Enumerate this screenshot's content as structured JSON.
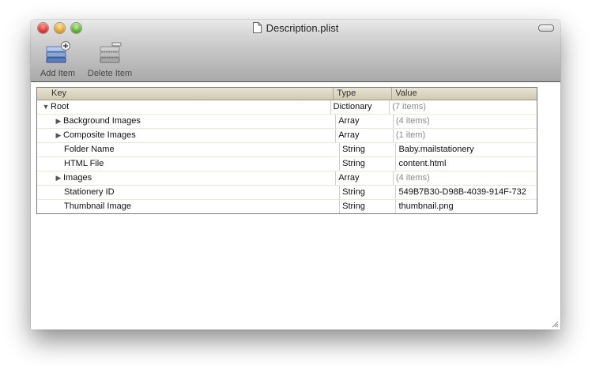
{
  "window": {
    "title": "Description.plist"
  },
  "toolbar": {
    "add_label": "Add Item",
    "delete_label": "Delete Item"
  },
  "table": {
    "headers": {
      "key": "Key",
      "type": "Type",
      "value": "Value"
    },
    "rows": [
      {
        "key": "Root",
        "type": "Dictionary",
        "value": "(7 items)",
        "expander": "expanded"
      },
      {
        "key": "Background Images",
        "type": "Array",
        "value": "(4 items)",
        "expander": "collapsed"
      },
      {
        "key": "Composite Images",
        "type": "Array",
        "value": "(1 item)",
        "expander": "collapsed"
      },
      {
        "key": "Folder Name",
        "type": "String",
        "value": "Baby.mailstationery",
        "expander": "none"
      },
      {
        "key": "HTML File",
        "type": "String",
        "value": "content.html",
        "expander": "none"
      },
      {
        "key": "Images",
        "type": "Array",
        "value": "(4 items)",
        "expander": "collapsed"
      },
      {
        "key": "Stationery ID",
        "type": "String",
        "value": "549B7B30-D98B-4039-914F-732",
        "expander": "none"
      },
      {
        "key": "Thumbnail Image",
        "type": "String",
        "value": "thumbnail.png",
        "expander": "none"
      }
    ]
  },
  "icons": {
    "close": "close-icon",
    "minimize": "minimize-icon",
    "zoom": "zoom-icon",
    "document": "document-icon",
    "add_item": "add-row-icon",
    "delete_item": "delete-row-icon",
    "expanded": "disclosure-down-icon",
    "collapsed": "disclosure-right-icon",
    "resize": "resize-grip-icon"
  },
  "colors": {
    "close": "#e0382a",
    "minimize": "#e6a82a",
    "zoom": "#5fb42f",
    "header_bg": "#dcd8c2",
    "dim_text": "#8a8a8a"
  }
}
